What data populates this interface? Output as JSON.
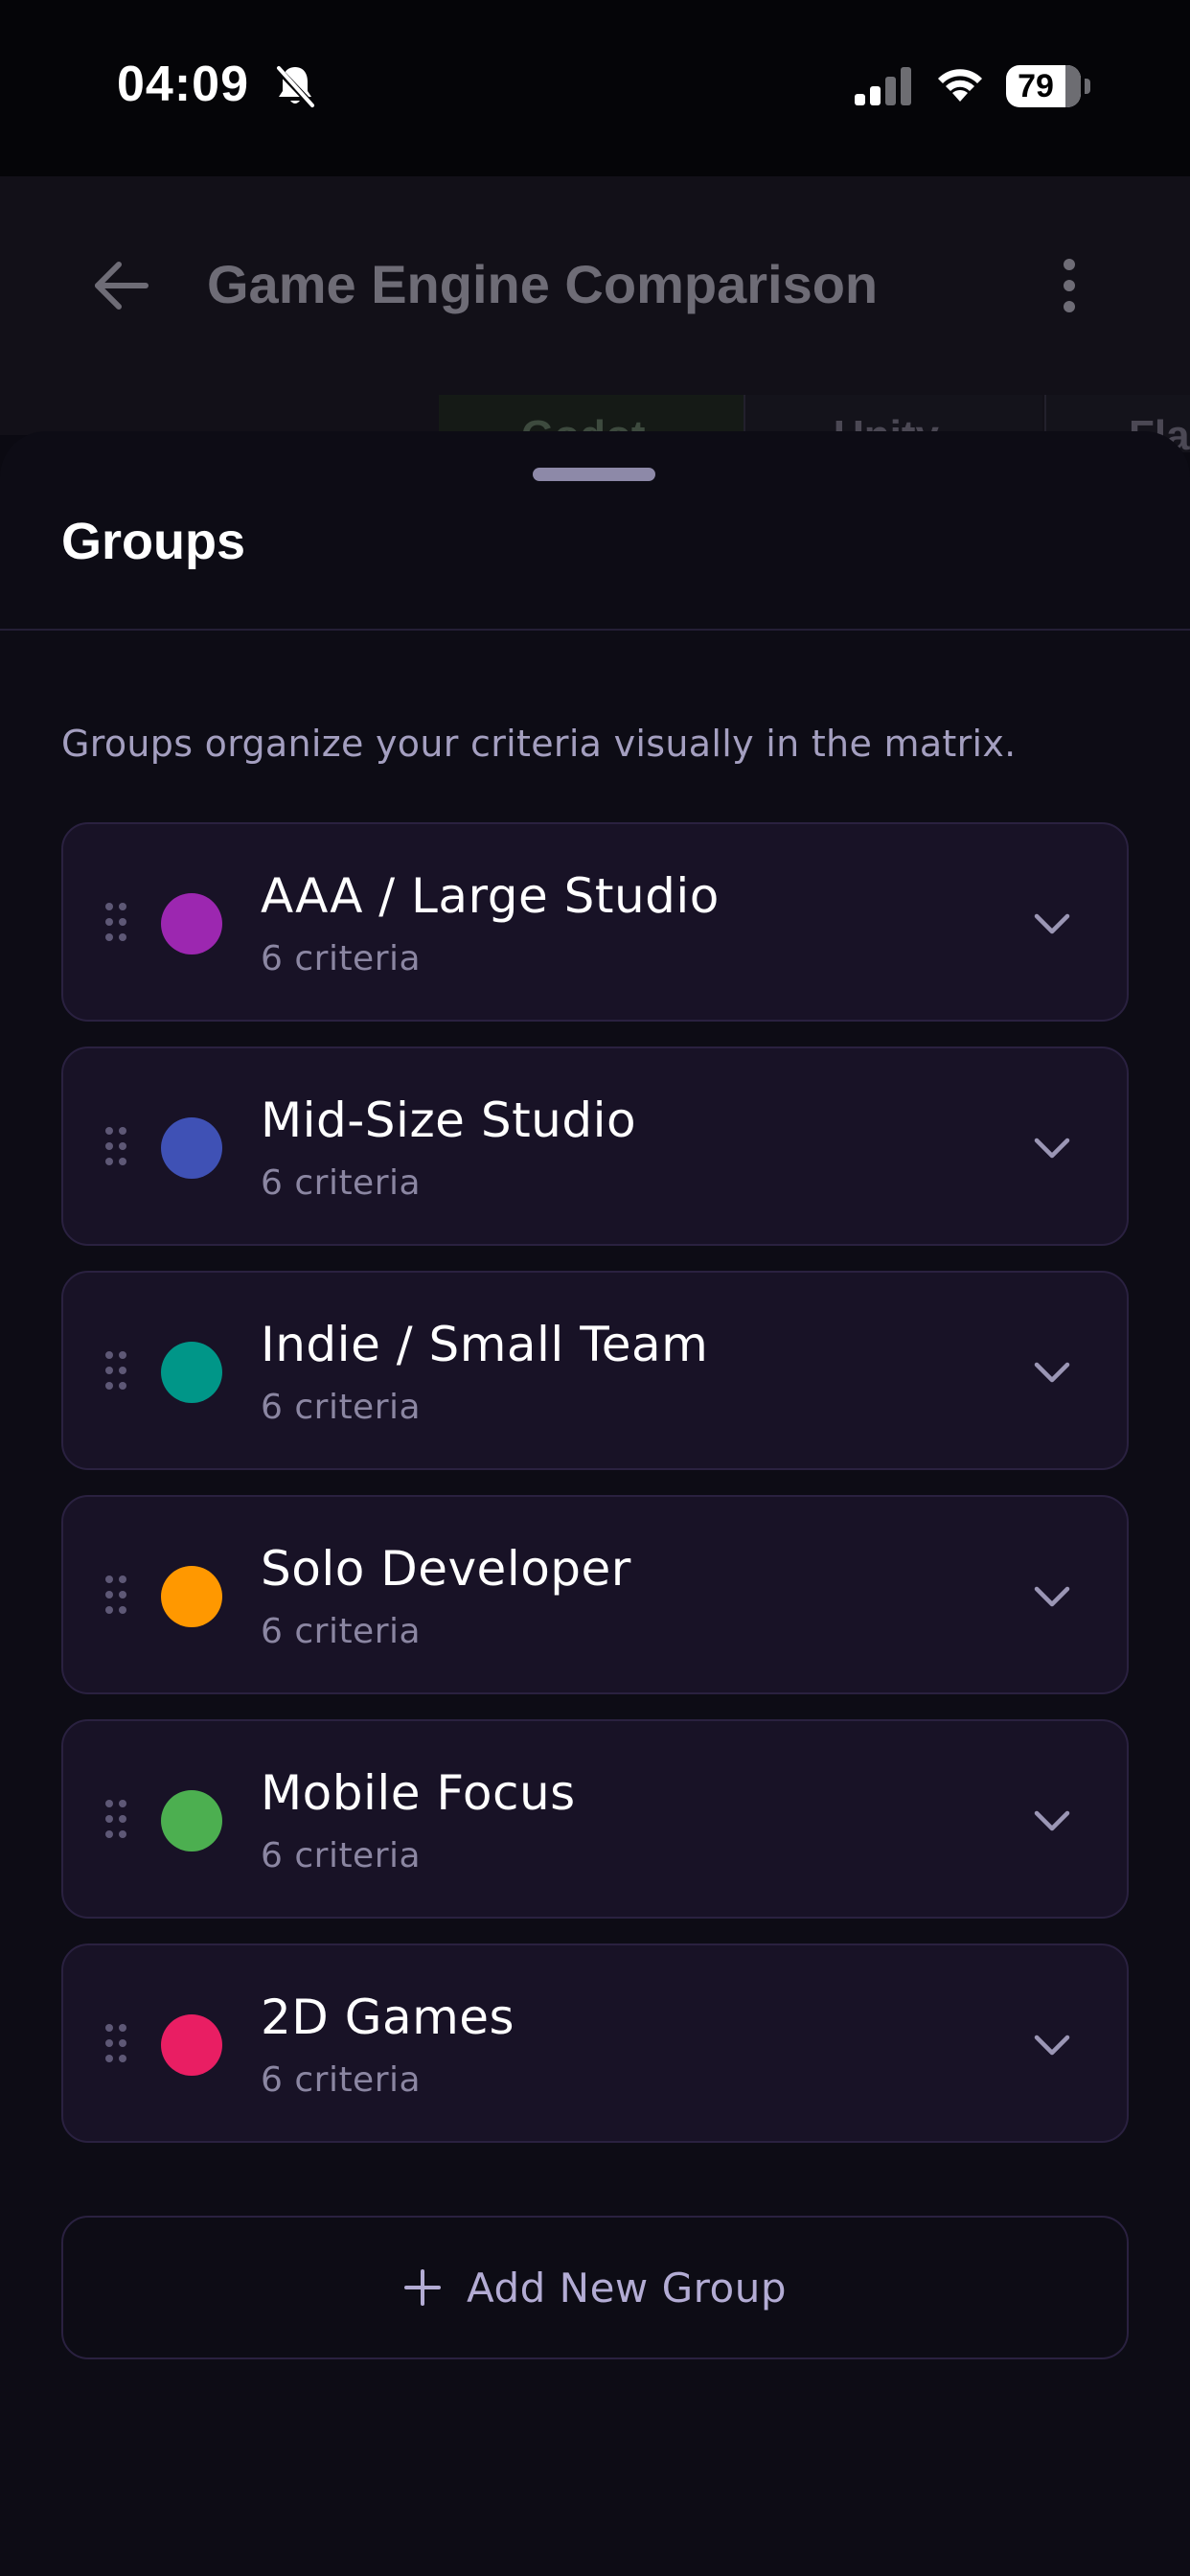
{
  "status_bar": {
    "time": "04:09",
    "battery": "79",
    "icons": [
      "bell-slash-icon",
      "cellular-signal-icon",
      "wifi-icon",
      "battery-icon"
    ]
  },
  "header": {
    "title": "Game Engine Comparison",
    "back_icon": "arrow-left-icon",
    "menu_icon": "more-vertical-icon",
    "column_tabs": [
      "Godot",
      "Unity",
      "Fla"
    ]
  },
  "sheet": {
    "title": "Groups",
    "description": "Groups organize your criteria visually in the matrix.",
    "groups": [
      {
        "name": "AAA / Large Studio",
        "count": "6 criteria",
        "color": "#9c27b0"
      },
      {
        "name": "Mid-Size Studio",
        "count": "6 criteria",
        "color": "#3f51b5"
      },
      {
        "name": "Indie / Small Team",
        "count": "6 criteria",
        "color": "#009688"
      },
      {
        "name": "Solo Developer",
        "count": "6 criteria",
        "color": "#ff9800"
      },
      {
        "name": "Mobile Focus",
        "count": "6 criteria",
        "color": "#4caf50"
      },
      {
        "name": "2D Games",
        "count": "6 criteria",
        "color": "#e91e63"
      }
    ],
    "add_button_label": "Add New Group"
  }
}
